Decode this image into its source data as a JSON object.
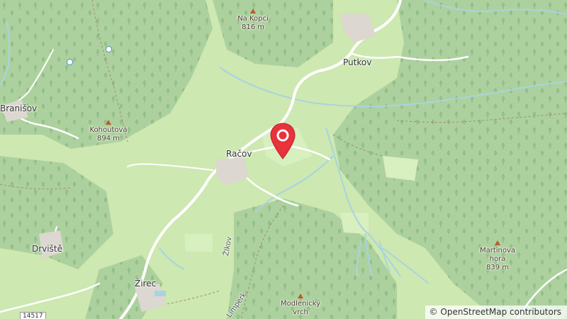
{
  "map": {
    "places": {
      "putkov": "Putkov",
      "branisov": "Branišov",
      "racov": "Račov",
      "drviste": "Drviště",
      "zirec": "Žirec"
    },
    "peaks": {
      "na_kopci": {
        "name": "Na Kopci",
        "elevation": "816 m"
      },
      "kohoutova": {
        "name": "Kohoutová",
        "elevation": "894 m"
      },
      "martinova": {
        "name": "Martinova hora",
        "name_line1": "Martinova",
        "name_line2": "hora",
        "elevation": "839 m"
      },
      "modlenicky": {
        "name_line1": "Modlenický",
        "name_line2": "vrch"
      }
    },
    "road_labels": {
      "zlkov": "Žlkov",
      "limperk": "Limperk",
      "road_number": "14517"
    },
    "colors": {
      "forest": "#add19e",
      "meadow": "#cde8b0",
      "road": "#ffffff",
      "water": "#aad3df",
      "marker": "#e8323c"
    },
    "icons": {
      "location_marker": "map-pin-icon",
      "peak": "triangle-icon"
    }
  },
  "attribution": {
    "copyright_symbol": "©",
    "text": "OpenStreetMap contributors"
  }
}
